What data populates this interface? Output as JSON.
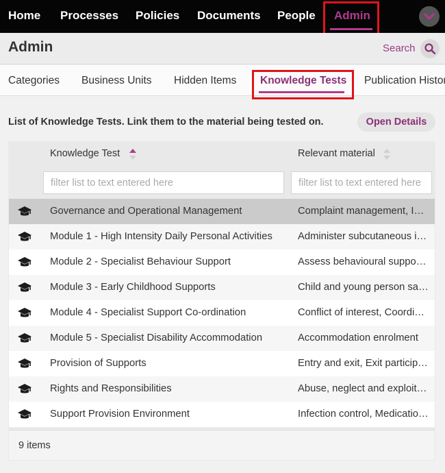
{
  "nav": {
    "items": [
      "Home",
      "Processes",
      "Policies",
      "Documents",
      "People",
      "Admin"
    ],
    "active": "Admin",
    "accent": "#b23a8e",
    "highlight_color": "#e3131b"
  },
  "header": {
    "title": "Admin",
    "search_label": "Search"
  },
  "tabs": {
    "items": [
      "Categories",
      "Business Units",
      "Hidden Items",
      "Knowledge Tests",
      "Publication History"
    ],
    "active": "Knowledge Tests"
  },
  "content": {
    "description": "List of Knowledge Tests. Link them to the material being tested on.",
    "open_details_label": "Open Details"
  },
  "table": {
    "columns": [
      {
        "label": "Knowledge Test",
        "sort": "ascending"
      },
      {
        "label": "Relevant material",
        "sort": "none"
      }
    ],
    "filter_placeholders": [
      "filter list to text entered here",
      "filter list to text entered here"
    ],
    "row_icon": "graduation-cap-icon",
    "rows": [
      {
        "name": "Governance and Operational Management",
        "material": "Complaint management, Incident management",
        "selected": true
      },
      {
        "name": "Module 1 - High Intensity Daily Personal Activities",
        "material": "Administer subcutaneous injections"
      },
      {
        "name": "Module 2 - Specialist Behaviour Support",
        "material": "Assess behavioural support needs"
      },
      {
        "name": "Module 3 - Early Childhood Supports",
        "material": "Child and young person safety"
      },
      {
        "name": "Module 4 - Specialist Support Co-ordination",
        "material": "Conflict of interest, Coordination"
      },
      {
        "name": "Module 5 - Specialist Disability Accommodation",
        "material": "Accommodation enrolment"
      },
      {
        "name": "Provision of Supports",
        "material": "Entry and exit, Exit participants"
      },
      {
        "name": "Rights and Responsibilities",
        "material": "Abuse, neglect and exploitation"
      },
      {
        "name": "Support Provision Environment",
        "material": "Infection control, Medication management"
      }
    ],
    "footer_count": "9 items"
  }
}
